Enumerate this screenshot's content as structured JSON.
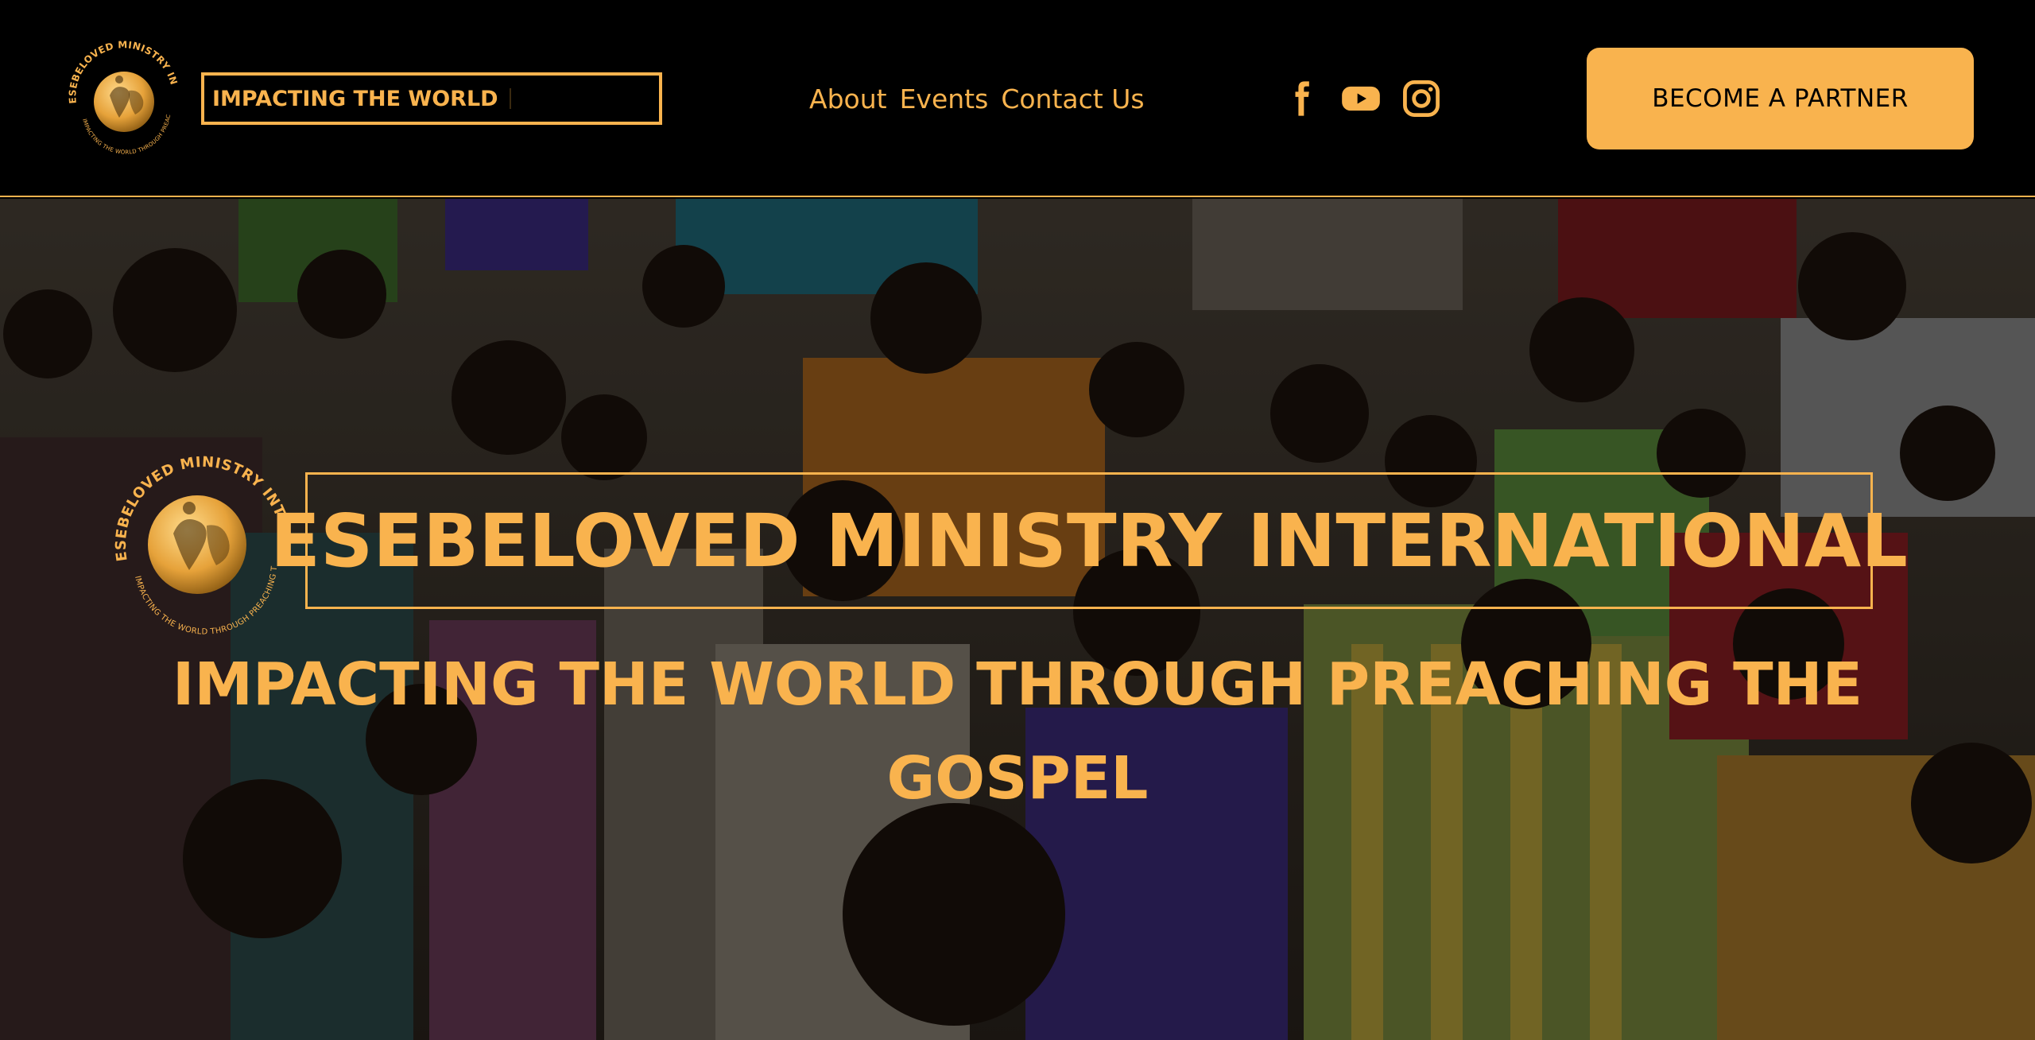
{
  "header": {
    "logo_alt": "ESEBELOVED MINISTRY INTERNATIONAL logo",
    "tagline": "IMPACTING THE WORLD",
    "nav": [
      "About",
      "Events",
      "Contact Us"
    ],
    "social_icons": [
      "facebook-icon",
      "youtube-icon",
      "instagram-icon"
    ],
    "cta_label": "BECOME A PARTNER"
  },
  "hero": {
    "title": "ESEBELOVED MINISTRY INTERNATIONAL",
    "subtitle": "IMPACTING THE WORLD THROUGH PREACHING THE GOSPEL",
    "background": "crowd-worship-photo"
  },
  "colors": {
    "accent": "#f9b34e",
    "header_bg": "#000000",
    "button_text": "#000000"
  }
}
